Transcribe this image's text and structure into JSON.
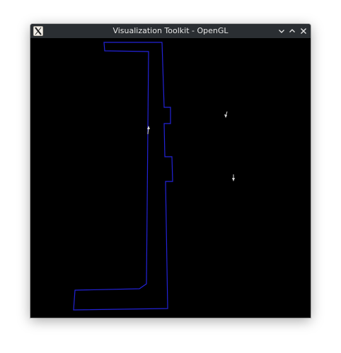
{
  "window": {
    "title": "Visualization Toolkit - OpenGL"
  },
  "colors": {
    "background": "#000000",
    "titlebar": "#2a2e32",
    "outline": "#2323d8",
    "arrow": "#d8d8d8"
  },
  "icons": {
    "app": "x-logo-icon",
    "minimize": "chevron-down-icon",
    "maximize": "chevron-up-icon",
    "close": "close-icon"
  }
}
